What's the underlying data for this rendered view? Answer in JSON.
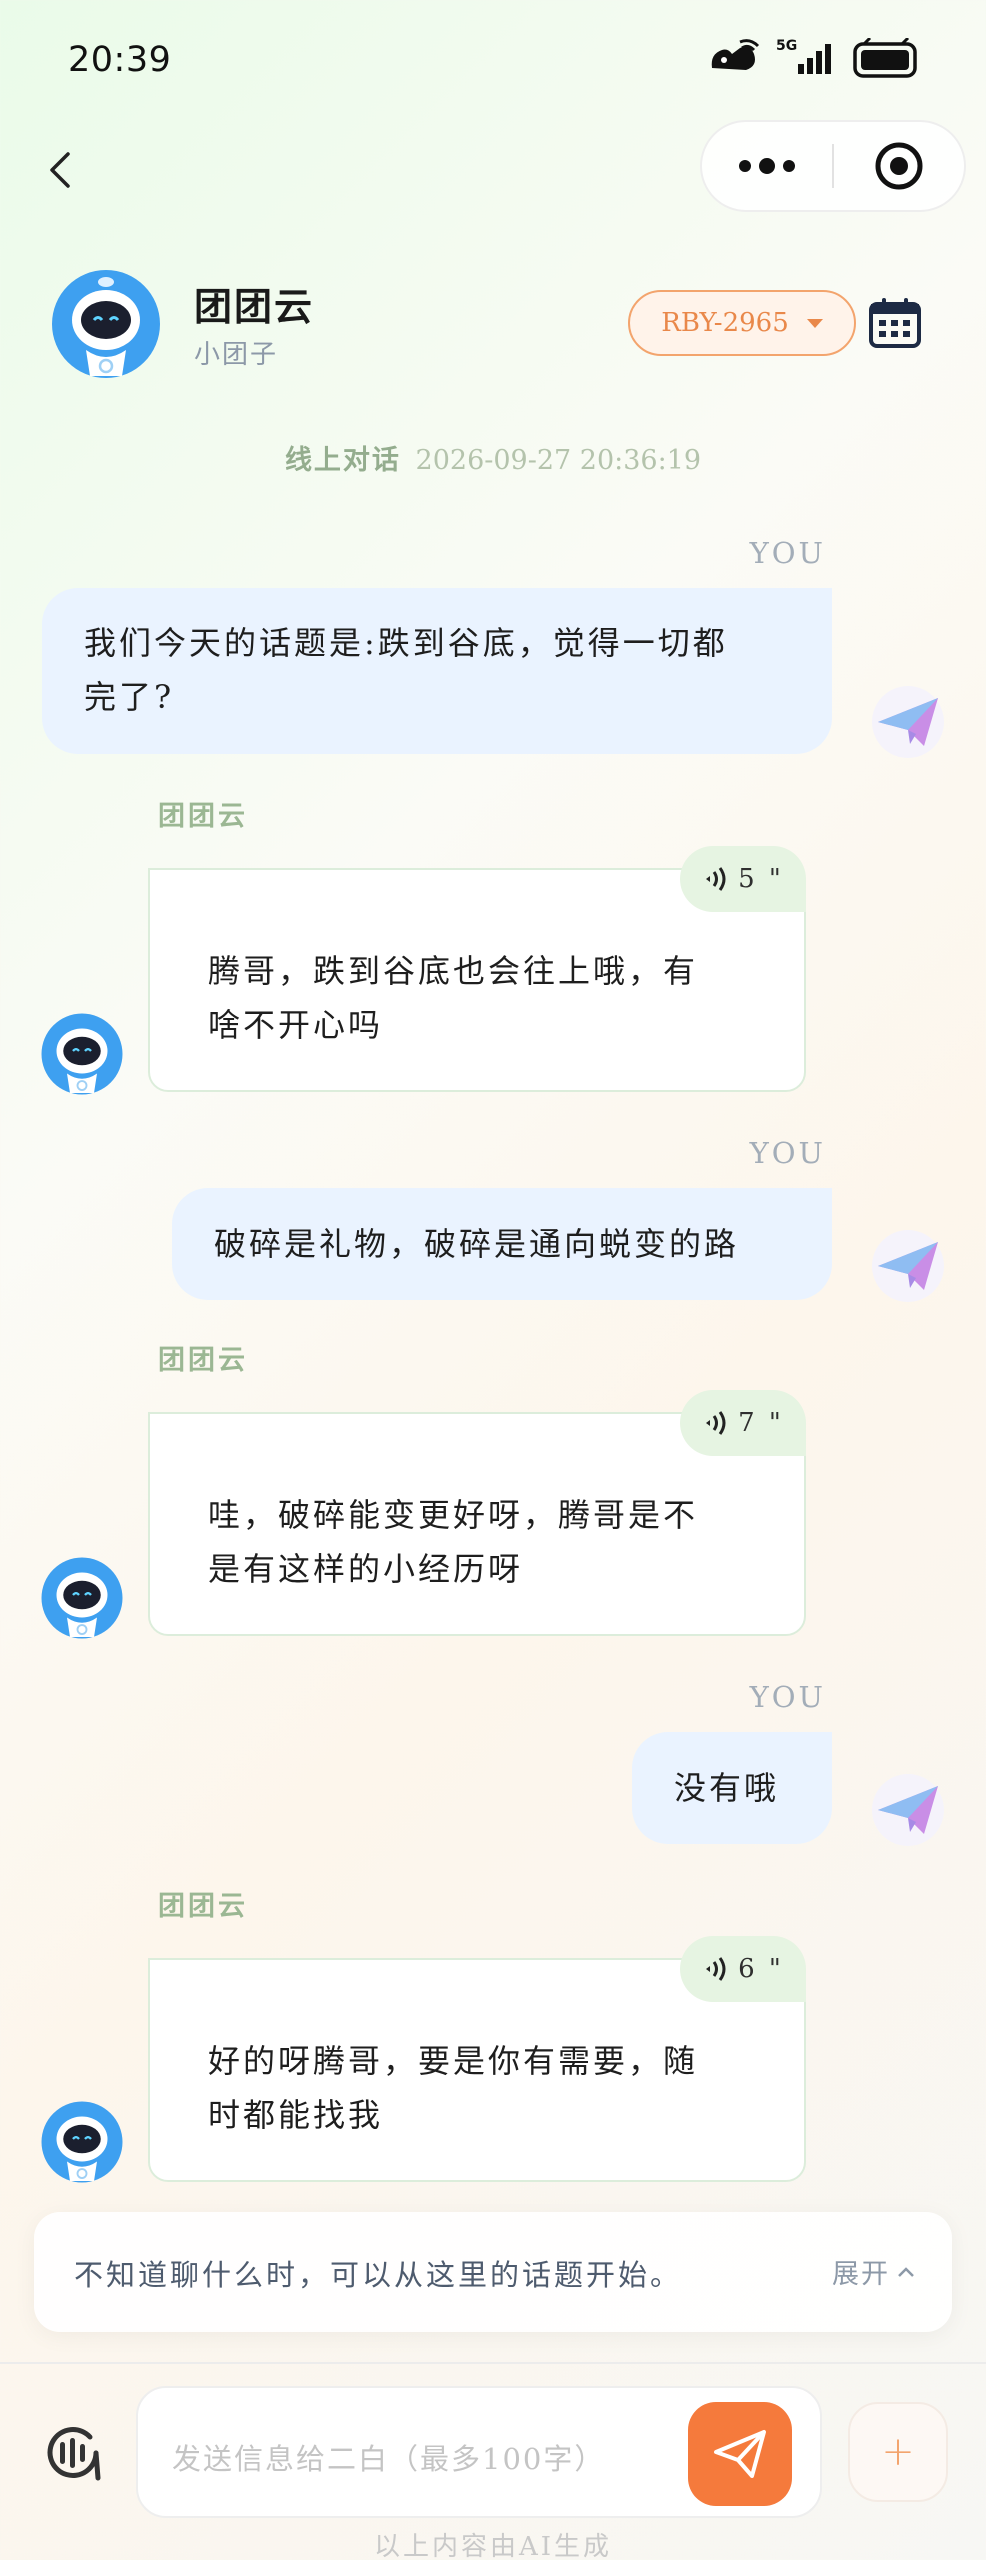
{
  "status_bar": {
    "time": "20:39",
    "network": "5G",
    "icons": [
      "nfc-icon",
      "wifi-icon",
      "signal-icon",
      "battery-icon"
    ]
  },
  "nav": {
    "back_icon": "chevron-left-icon",
    "more_icon": "more-dots-icon",
    "target_icon": "target-circle-icon"
  },
  "header": {
    "bot_name": "团团云",
    "bot_subtitle": "小团子",
    "device_selected": "RBY-2965",
    "calendar_icon": "calendar-icon"
  },
  "conversation": {
    "timestamp_label": "线上对话",
    "timestamp_value": "2026-09-27 20:36:19",
    "messages": [
      {
        "role": "user",
        "label": "YOU",
        "text_lines": [
          "我们今天的话题是:跌到谷底，觉得一切都",
          "完了?"
        ]
      },
      {
        "role": "bot",
        "label": "团团云",
        "voice_seconds": "5 \"",
        "text_lines": [
          "腾哥，跌到谷底也会往上哦，有",
          "啥不开心吗"
        ]
      },
      {
        "role": "user",
        "label": "YOU",
        "text_lines": [
          "破碎是礼物，破碎是通向蜕变的路"
        ]
      },
      {
        "role": "bot",
        "label": "团团云",
        "voice_seconds": "7 \"",
        "text_lines": [
          "哇，破碎能变更好呀，腾哥是不",
          "是有这样的小经历呀"
        ]
      },
      {
        "role": "user",
        "label": "YOU",
        "text_lines": [
          "没有哦"
        ]
      },
      {
        "role": "bot",
        "label": "团团云",
        "voice_seconds": "6 \"",
        "text_lines": [
          "好的呀腾哥，要是你有需要，随",
          "时都能找我"
        ]
      }
    ]
  },
  "topic_hint": {
    "text": "不知道聊什么时，可以从这里的话题开始。",
    "expand_label": "展开"
  },
  "composer": {
    "placeholder": "发送信息给二白（最多100字）",
    "send_icon": "paper-plane-icon",
    "voice_icon": "voice-wave-icon",
    "plus_label": "+"
  },
  "footer_note": "以上内容由AI生成",
  "colors": {
    "accent": "#f57a3c",
    "user_bubble": "#eaf3ff",
    "bot_border": "#dceddb",
    "voice_badge": "#e6f4e2"
  }
}
